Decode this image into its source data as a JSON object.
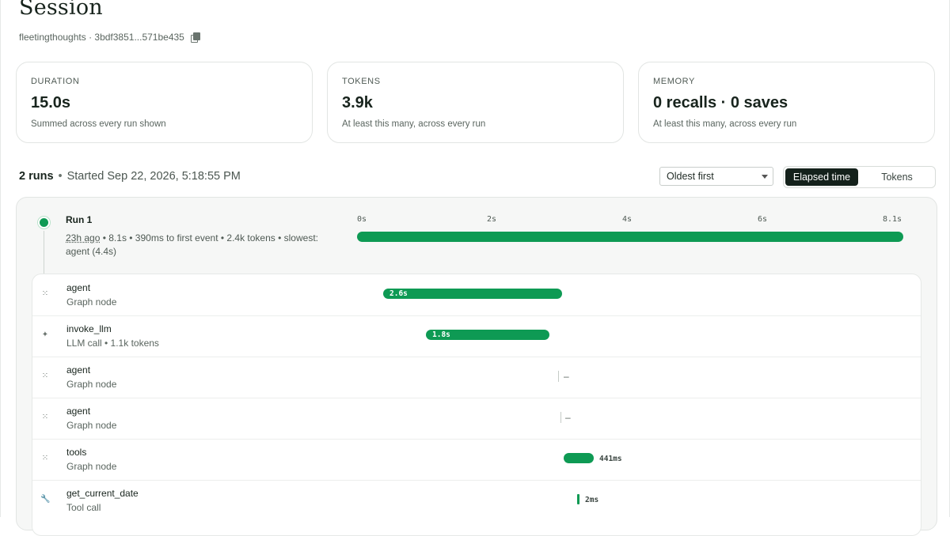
{
  "header": {
    "title": "Session",
    "subtitle": "fleetingthoughts · 3bdf3851...571be435"
  },
  "cards": [
    {
      "label": "DURATION",
      "value": "15.0s",
      "note": "Summed across every run shown"
    },
    {
      "label": "TOKENS",
      "value": "3.9k",
      "note": "At least this many, across every run"
    },
    {
      "label": "MEMORY",
      "value": "0 recalls · 0 saves",
      "note": "At least this many, across every run"
    }
  ],
  "runs_summary": {
    "count": "2 runs",
    "started": "Started Sep 22, 2026, 5:18:55 PM"
  },
  "controls": {
    "sort_value": "Oldest first",
    "toggle": {
      "active": "Elapsed time",
      "inactive": "Tokens"
    }
  },
  "run": {
    "title": "Run 1",
    "ago": "23h ago",
    "meta": " • 8.1s • 390ms to first event • 2.4k tokens • slowest: agent (4.4s)",
    "ticks": [
      "0s",
      "2s",
      "4s",
      "6s",
      "8.1s"
    ]
  },
  "steps": [
    {
      "name": "agent",
      "kind": "Graph node",
      "icon": "graph-node-icon",
      "duration": "2.6s"
    },
    {
      "name": "invoke_llm",
      "kind": "LLM call • 1.1k tokens",
      "icon": "sparkle-icon",
      "duration": "1.8s"
    },
    {
      "name": "agent",
      "kind": "Graph node",
      "icon": "graph-node-icon",
      "duration": "–"
    },
    {
      "name": "agent",
      "kind": "Graph node",
      "icon": "graph-node-icon",
      "duration": "–"
    },
    {
      "name": "tools",
      "kind": "Graph node",
      "icon": "graph-node-icon",
      "duration": "441ms"
    },
    {
      "name": "get_current_date",
      "kind": "Tool call",
      "icon": "wrench-icon",
      "duration": "2ms"
    }
  ],
  "colors": {
    "accent": "#0e9a54",
    "toggle_active": "#14211b"
  }
}
